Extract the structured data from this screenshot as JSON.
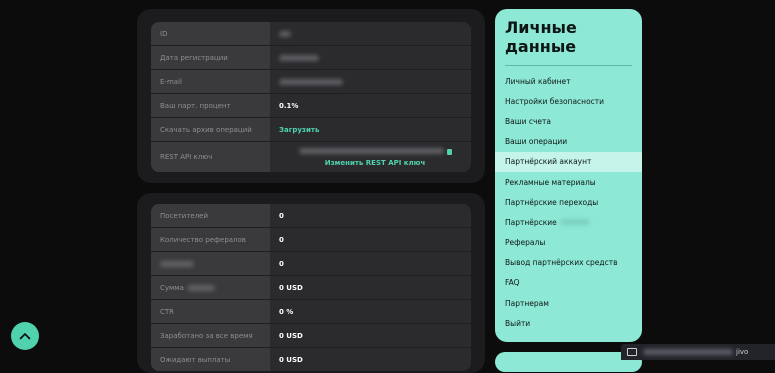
{
  "card1": {
    "rows": [
      {
        "label": "ID",
        "value": ""
      },
      {
        "label": "Дата регистрации",
        "value": ""
      },
      {
        "label": "E-mail",
        "value": ""
      },
      {
        "label": "Ваш парт. процент",
        "value": "0.1%"
      },
      {
        "label": "Скачать архив операций",
        "value": "Загрузить"
      },
      {
        "label": "REST API ключ",
        "value": "",
        "link": "Изменить REST API ключ"
      }
    ]
  },
  "card2": {
    "rows": [
      {
        "label": "Посетителей",
        "value": "0"
      },
      {
        "label": "Количество рефералов",
        "value": "0"
      },
      {
        "label": "",
        "value": "0"
      },
      {
        "label": "Сумма",
        "value": "0 USD"
      },
      {
        "label": "CTR",
        "value": "0 %"
      },
      {
        "label": "Заработано за все время",
        "value": "0 USD"
      },
      {
        "label": "Ожидают выплаты",
        "value": "0 USD"
      }
    ]
  },
  "sidebar": {
    "title": "Личные данные",
    "items": [
      {
        "label": "Личный кабинет"
      },
      {
        "label": "Настройки безопасности"
      },
      {
        "label": "Ваши счета"
      },
      {
        "label": "Ваши операции"
      },
      {
        "label": "Партнёрский аккаунт"
      },
      {
        "label": "Рекламные материалы"
      },
      {
        "label": "Партнёрские переходы"
      },
      {
        "label": "Партнёрские"
      },
      {
        "label": "Рефералы"
      },
      {
        "label": "Вывод партнёрских средств"
      },
      {
        "label": "FAQ"
      },
      {
        "label": "Партнерам"
      },
      {
        "label": "Выйти"
      }
    ],
    "active_index": 4
  },
  "chat": {
    "text": "jivo"
  },
  "colors": {
    "accent": "#4fd2ad",
    "panel": "#8de8d6",
    "active": "#c4f4ea",
    "card": "#1c1c1e"
  },
  "icons": {
    "fab": "chevron-up-icon",
    "chat": "envelope-icon",
    "copy": "copy-icon"
  }
}
